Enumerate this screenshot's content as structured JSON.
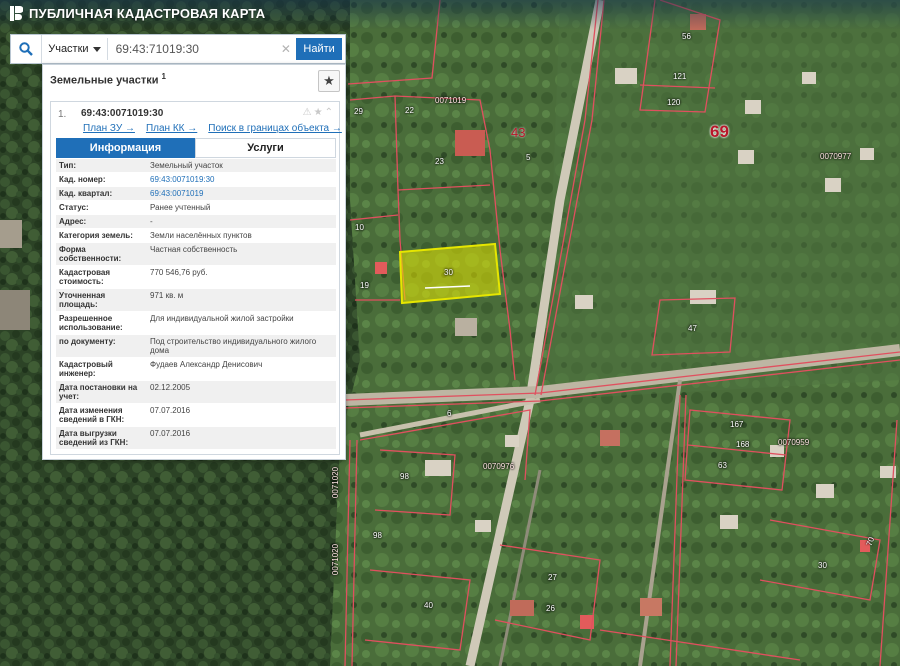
{
  "app": {
    "title": "ПУБЛИЧНАЯ КАДАСТРОВАЯ КАРТА"
  },
  "search": {
    "type_label": "Участки",
    "query": "69:43:71019:30",
    "button_label": "Найти"
  },
  "panel": {
    "title": "Земельные участки",
    "count": "1"
  },
  "result": {
    "index": "1.",
    "cad_number": "69:43:0071019:30",
    "links": [
      "План ЗУ →",
      "План КК →",
      "Поиск в границах объекта →"
    ],
    "tabs": {
      "info": "Информация",
      "services": "Услуги"
    },
    "attributes": [
      {
        "label": "Тип:",
        "value": "Земельный участок"
      },
      {
        "label": "Кад. номер:",
        "value": "69:43:0071019:30"
      },
      {
        "label": "Кад. квартал:",
        "value": "69:43:0071019"
      },
      {
        "label": "Статус:",
        "value": "Ранее учтенный"
      },
      {
        "label": "Адрес:",
        "value": "-"
      },
      {
        "label": "Категория земель:",
        "value": "Земли населённых пунктов"
      },
      {
        "label": "Форма собственности:",
        "value": "Частная собственность"
      },
      {
        "label": "Кадастровая стоимость:",
        "value": "770 546,76 руб."
      },
      {
        "label": "Уточненная площадь:",
        "value": "971 кв. м"
      },
      {
        "label": "Разрешенное использование:",
        "value": "Для индивидуальной жилой застройки"
      },
      {
        "label": "по документу:",
        "value": "Под строительство индивидуального жилого дома"
      },
      {
        "label": "Кадастровый инженер:",
        "value": "Фудаев Александр Денисович"
      },
      {
        "label": "Дата постановки на учет:",
        "value": "02.12.2005"
      },
      {
        "label": "Дата изменения сведений в ГКН:",
        "value": "07.07.2016"
      },
      {
        "label": "Дата выгрузки сведений из ГКН:",
        "value": "07.07.2016"
      }
    ]
  },
  "map_labels": {
    "q1": "0071019",
    "q2": "0070977",
    "q3": "0070976",
    "q4": "0070959",
    "q5": "0071020",
    "q6": "0071020",
    "d43": "43",
    "d69": "69",
    "p56": "56",
    "p121": "121",
    "p120": "120",
    "p29": "29",
    "p22": "22",
    "p23": "23",
    "p5": "5",
    "p10": "10",
    "p19": "19",
    "p30": "30",
    "p47": "47",
    "p6": "6",
    "p167": "167",
    "p168": "168",
    "p63": "63",
    "p98a": "98",
    "p98b": "98",
    "p27": "27",
    "p26": "26",
    "p40": "40",
    "p30b": "30",
    "p70": "70"
  },
  "colors": {
    "accent": "#1f6fb8",
    "parcel_border": "#e0505f",
    "selected_fill": "#e6e600"
  }
}
